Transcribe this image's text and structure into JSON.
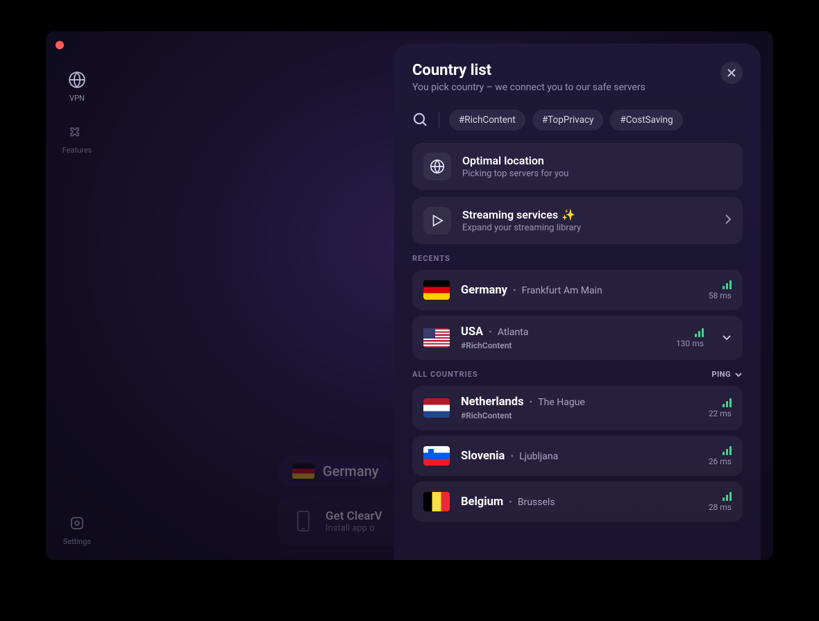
{
  "sidebar": {
    "items": [
      {
        "label": "VPN"
      },
      {
        "label": "Features"
      }
    ],
    "settings_label": "Settings"
  },
  "background": {
    "selected_country": "Germany",
    "promo_title": "Get ClearV",
    "promo_sub": "Install app o"
  },
  "panel": {
    "title": "Country list",
    "subtitle": "You pick country – we connect you to our safe servers",
    "tags": [
      "#RichContent",
      "#TopPrivacy",
      "#CostSaving"
    ],
    "optimal": {
      "title": "Optimal location",
      "sub": "Picking top servers for you"
    },
    "streaming": {
      "title": "Streaming services",
      "sparkle": "✨",
      "sub": "Expand your streaming library"
    },
    "recents_label": "RECENTS",
    "all_label": "ALL COUNTRIES",
    "ping_label": "PING",
    "recents": [
      {
        "name": "Germany",
        "city": "Frankfurt Am Main",
        "ping": "58 ms",
        "flag": "de"
      },
      {
        "name": "USA",
        "city": "Atlanta",
        "ping": "130 ms",
        "flag": "us",
        "tag": "#RichContent",
        "expandable": true
      }
    ],
    "countries": [
      {
        "name": "Netherlands",
        "city": "The Hague",
        "ping": "22 ms",
        "flag": "nl",
        "tag": "#RichContent"
      },
      {
        "name": "Slovenia",
        "city": "Ljubljana",
        "ping": "26 ms",
        "flag": "si"
      },
      {
        "name": "Belgium",
        "city": "Brussels",
        "ping": "28 ms",
        "flag": "be"
      }
    ]
  }
}
